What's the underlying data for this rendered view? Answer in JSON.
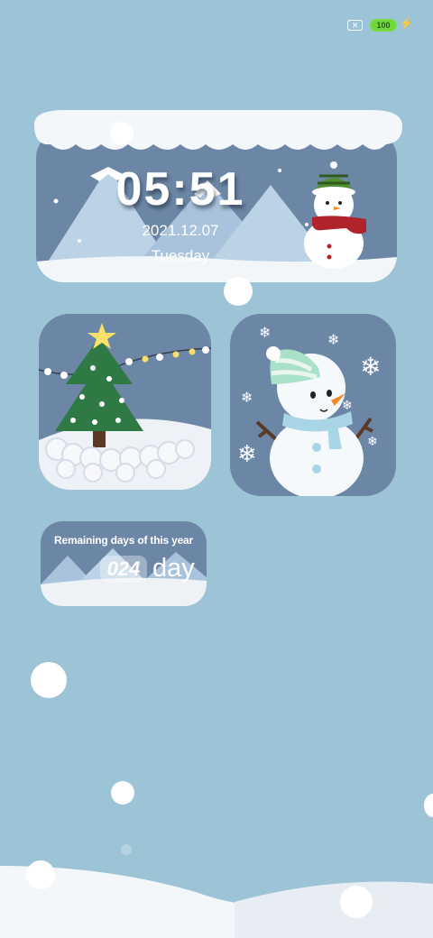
{
  "status_bar": {
    "sim_icon": "sim-off-icon",
    "sim_glyph": "✕",
    "battery_level": "100",
    "charging_icon": "lightning-bolt-icon",
    "charging_glyph": "⚡"
  },
  "clock_widget": {
    "time": "05:51",
    "date": "2021.12.07",
    "weekday": "Tuesday"
  },
  "days_widget": {
    "title": "Remaining days of this year",
    "count": "024",
    "unit": "day"
  },
  "colors": {
    "background": "#9dc3d7",
    "widget_panel": "#6c87a6",
    "battery": "#6fd93c",
    "tree_green": "#2f7a44",
    "scarf_red": "#b0232b",
    "hat_green": "#4f8f2f",
    "snowman_hat_mint": "#a8e0c8"
  }
}
